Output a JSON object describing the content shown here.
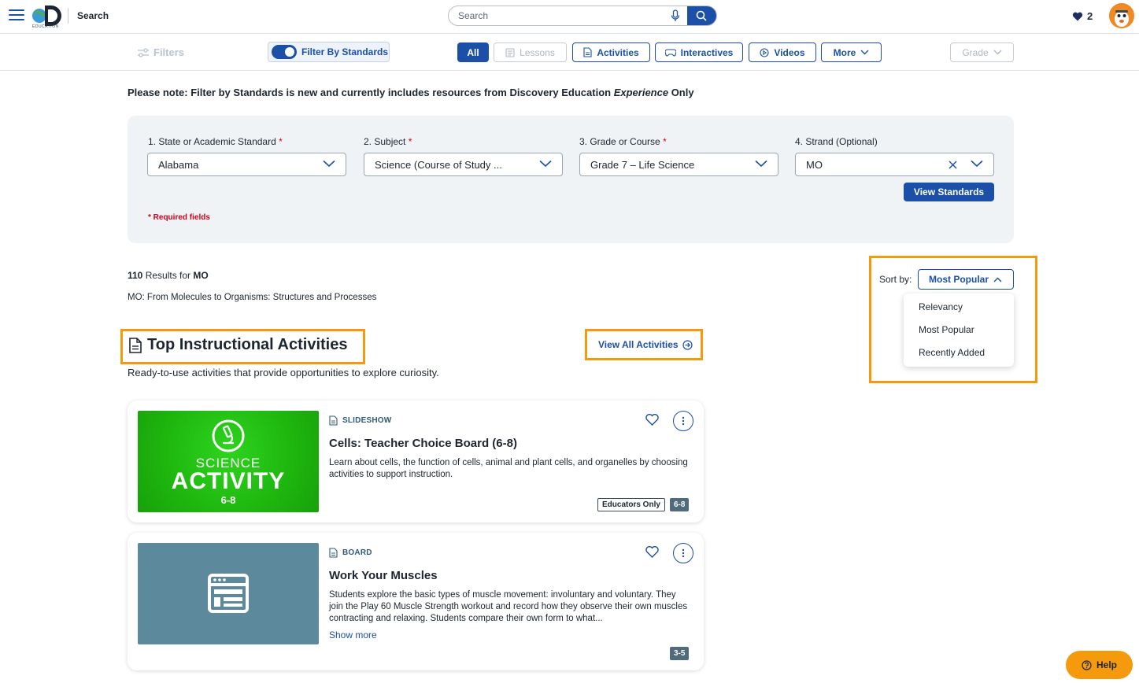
{
  "header": {
    "title": "Search",
    "logo_text": "EDUCATION",
    "search_placeholder": "Search",
    "favorites_count": "2"
  },
  "filterbar": {
    "filters_label": "Filters",
    "toggle_label": "Filter By Standards",
    "chips": {
      "all": "All",
      "lessons": "Lessons",
      "activities": "Activities",
      "interactives": "Interactives",
      "videos": "Videos",
      "more": "More",
      "grade": "Grade"
    }
  },
  "note": {
    "prefix": "Please note: Filter by Standards is new and currently includes resources from Discovery Education ",
    "emphasis": "Experience",
    "suffix": " Only"
  },
  "standards": {
    "fields": [
      {
        "label": "1. State or Academic Standard",
        "required": "*",
        "value": "Alabama"
      },
      {
        "label": "2. Subject",
        "required": "*",
        "value": "Science (Course of Study ..."
      },
      {
        "label": "3. Grade or Course",
        "required": "*",
        "value": "Grade 7 – Life Science"
      },
      {
        "label": "4. Strand (Optional)",
        "required": "",
        "value": "MO"
      }
    ],
    "view_button": "View Standards",
    "required_note": "* Required fields"
  },
  "results": {
    "count": "110",
    "results_for": " Results for ",
    "query": "MO",
    "description": "MO: From Molecules to Organisms: Structures and Processes"
  },
  "sort": {
    "label": "Sort by:",
    "selected": "Most Popular",
    "options": [
      "Relevancy",
      "Most Popular",
      "Recently Added"
    ]
  },
  "section": {
    "title": "Top Instructional Activities",
    "view_all": "View All Activities",
    "description": "Ready-to-use activities that provide opportunities to explore curiosity."
  },
  "cards": [
    {
      "type": "SLIDESHOW",
      "title": "Cells: Teacher Choice Board (6-8)",
      "description": "Learn about cells, the function of cells, animal and plant cells, and organelles by choosing activities to support instruction.",
      "thumb_line1": "SCIENCE",
      "thumb_line2": "ACTIVITY",
      "thumb_line3": "6-8",
      "badge_outline": "Educators Only",
      "badge_grade": "6-8"
    },
    {
      "type": "BOARD",
      "title": "Work Your Muscles",
      "description": "Students explore the basic types of muscle movement: involuntary and voluntary. They join the Play 60 Muscle Strength workout and record how they observe their own muscles contracting and relaxing. Students compare their own form to what...",
      "show_more": "Show more",
      "badge_grade": "3-5"
    }
  ],
  "help": {
    "label": "Help"
  },
  "colors": {
    "primary": "#1c4fa8",
    "highlight": "#f59a0c",
    "required": "#d0021b"
  }
}
